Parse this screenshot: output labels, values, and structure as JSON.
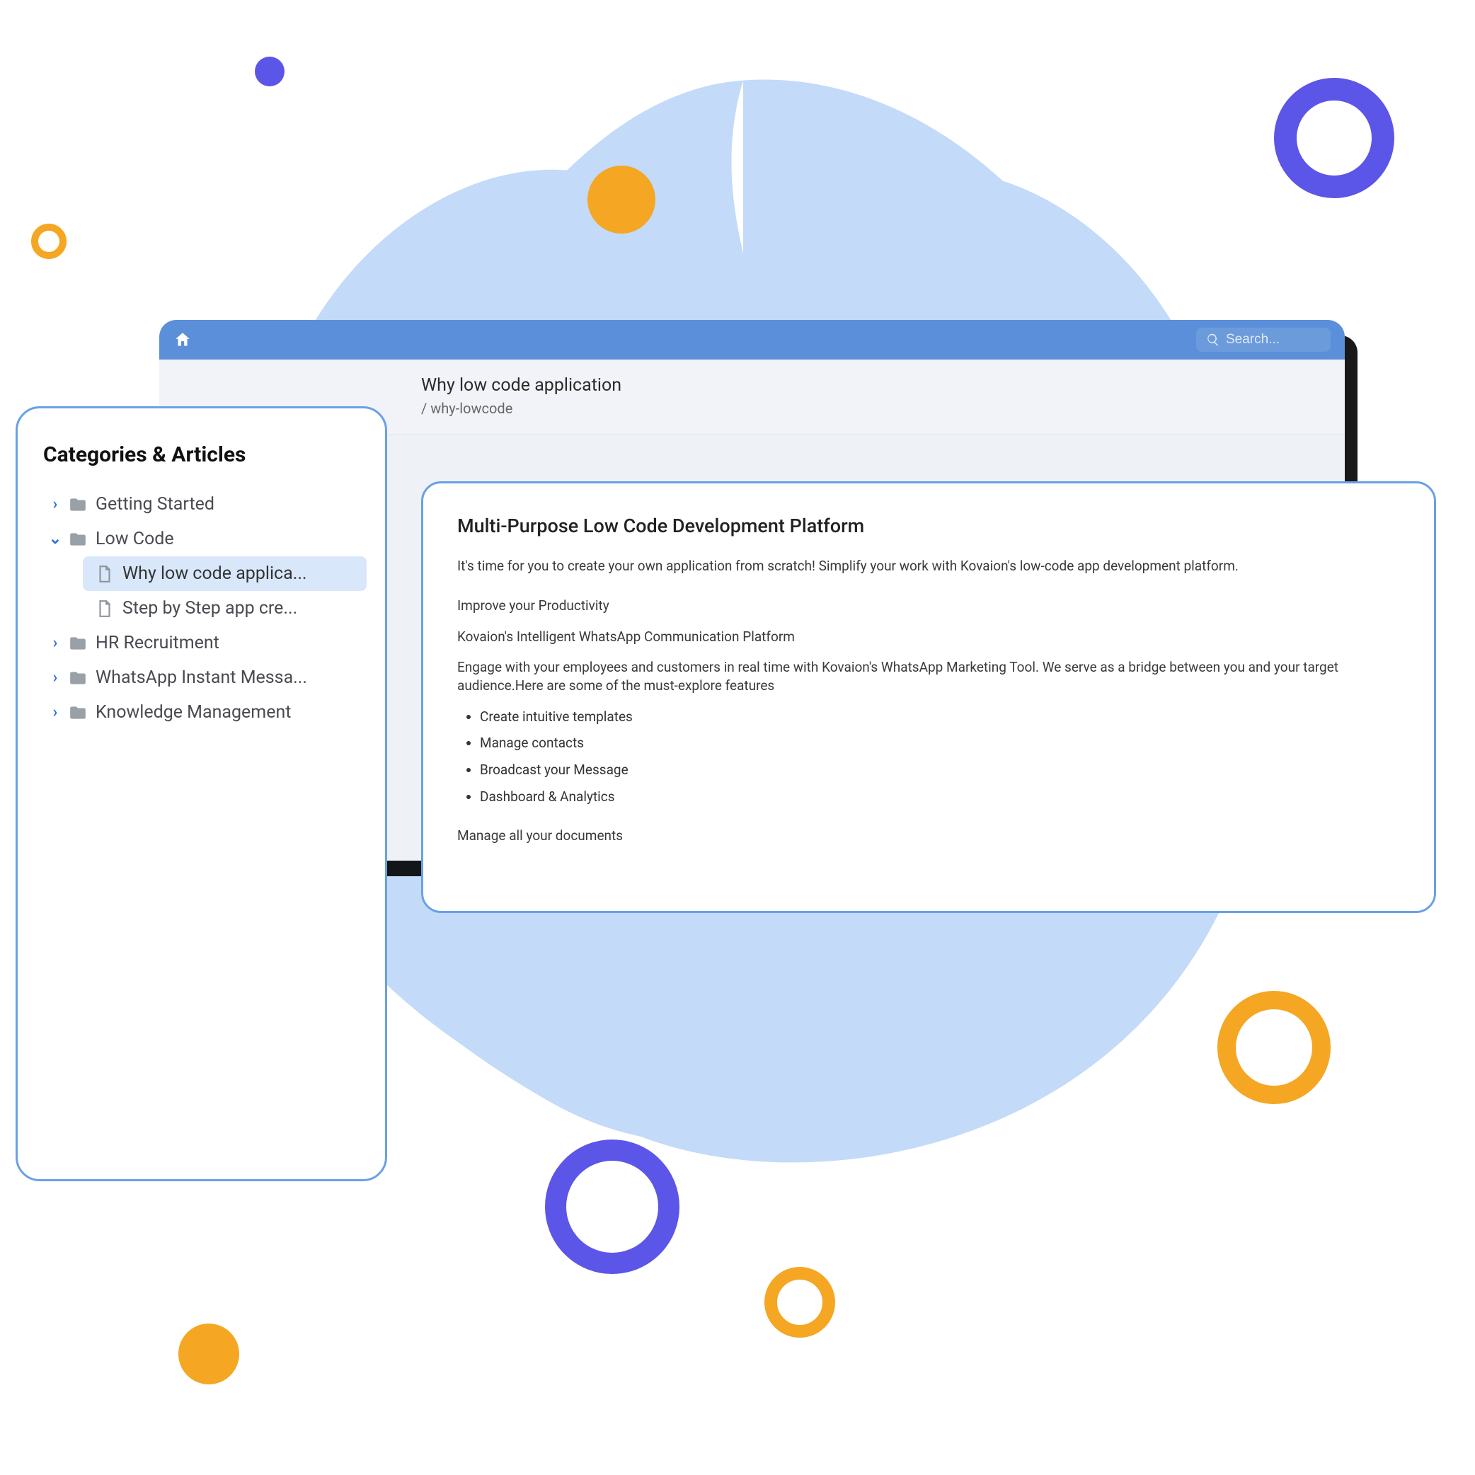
{
  "sidebar": {
    "title": "Categories & Articles",
    "items": [
      {
        "label": "Getting Started",
        "expanded": false
      },
      {
        "label": "Low Code",
        "expanded": true,
        "children": [
          {
            "label": "Why low code applica...",
            "selected": true
          },
          {
            "label": "Step by Step app cre...",
            "selected": false
          }
        ]
      },
      {
        "label": "HR Recruitment",
        "expanded": false
      },
      {
        "label": "WhatsApp Instant Messa...",
        "expanded": false
      },
      {
        "label": "Knowledge Management",
        "expanded": false
      }
    ]
  },
  "header": {
    "search_placeholder": "Search...",
    "page_title": "Why low code application",
    "page_slug": "/ why-lowcode"
  },
  "article": {
    "heading": "Multi-Purpose Low Code Development Platform",
    "intro": "It's time for you to create your own application from scratch! Simplify your work with Kovaion's low-code app development platform.",
    "productivity": "Improve your Productivity",
    "platform_line": "Kovaion's Intelligent WhatsApp Communication Platform",
    "engage": "Engage with your employees and customers in real time with Kovaion's WhatsApp Marketing Tool. We serve as a bridge between you and your target audience.Here are some of the must-explore features",
    "features": [
      "Create intuitive templates",
      "Manage contacts",
      "Broadcast your Message",
      "Dashboard & Analytics"
    ],
    "manage_docs": "Manage all your documents"
  },
  "colors": {
    "blob": "#c3daf8",
    "appbar": "#5b8fd9",
    "accent_border": "#6aa0e7",
    "orange": "#f5a623",
    "indigo": "#5b55e8"
  }
}
